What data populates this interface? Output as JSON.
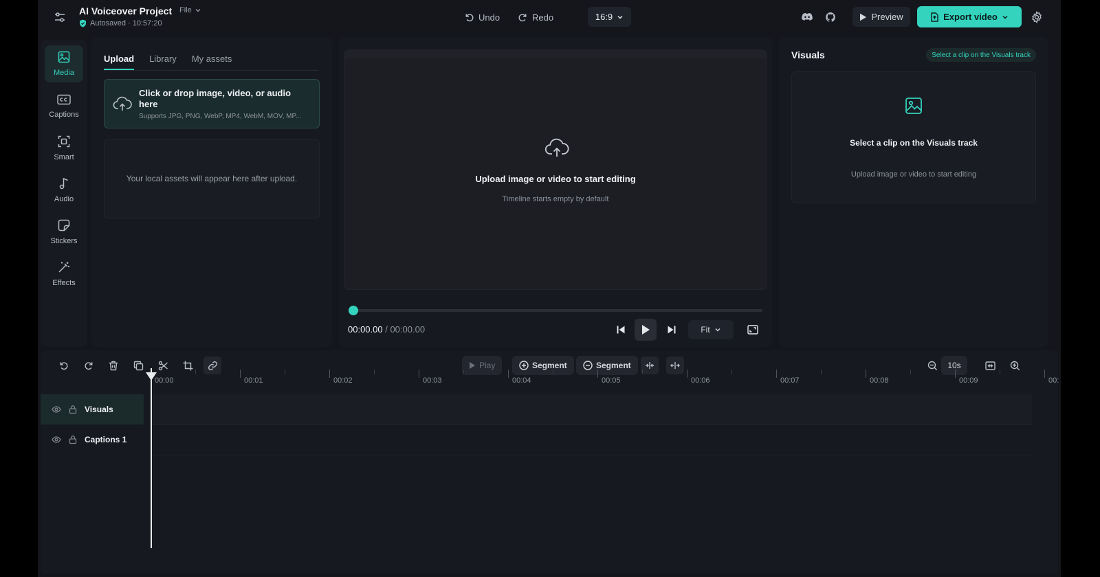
{
  "header": {
    "title": "AI Voiceover Project",
    "file_menu": "File",
    "autosave": "Autosaved · 10:57:20",
    "undo": "Undo",
    "redo": "Redo",
    "ratio": "16:9",
    "preview": "Preview",
    "export": "Export video",
    "accent": "#33d3be"
  },
  "rail": {
    "items": [
      {
        "label": "Media",
        "icon": "image-icon"
      },
      {
        "label": "Captions",
        "icon": "captions-icon"
      },
      {
        "label": "Smart",
        "icon": "smart-scan-icon"
      },
      {
        "label": "Audio",
        "icon": "music-note-icon"
      },
      {
        "label": "Stickers",
        "icon": "sticker-icon"
      },
      {
        "label": "Effects",
        "icon": "magic-wand-icon"
      }
    ]
  },
  "media": {
    "tabs": [
      "Upload",
      "Library",
      "My assets"
    ],
    "upload_title": "Click or drop image, video, or audio here",
    "upload_sub": "Supports JPG, PNG, WebP, MP4, WebM, MOV, MP...",
    "assets_empty": "Your local assets will appear here after upload."
  },
  "preview": {
    "title": "Upload image or video to start editing",
    "sub": "Timeline starts empty by default",
    "time_current": "00:00.00",
    "time_sep": " / ",
    "time_total": "00:00.00",
    "fit": "Fit",
    "progress": 0
  },
  "visuals": {
    "title": "Visuals",
    "badge": "Select a clip on the Visuals track",
    "card_title": "Select a clip on the Visuals track",
    "card_sub": "Upload image or video to start editing"
  },
  "timeline": {
    "play": "Play",
    "segment_add": "Segment",
    "segment_remove": "Segment",
    "zoom": "10s",
    "ticks": [
      "00:00",
      "00:01",
      "00:02",
      "00:03",
      "00:04",
      "00:05",
      "00:06",
      "00:07",
      "00:08",
      "00:09",
      "00:"
    ],
    "tracks": [
      {
        "name": "Visuals"
      },
      {
        "name": "Captions 1"
      }
    ]
  }
}
